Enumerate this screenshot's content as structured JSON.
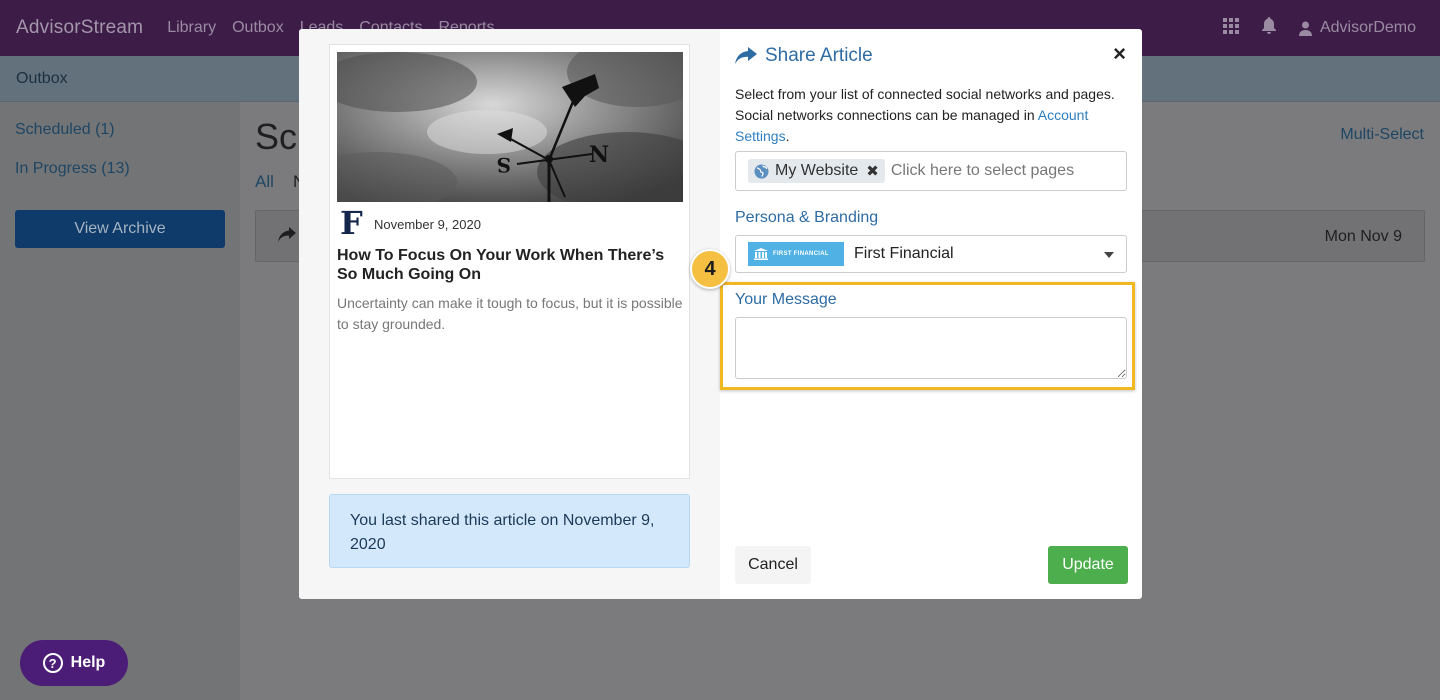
{
  "app": {
    "brand": "AdvisorStream",
    "nav": [
      "Library",
      "Outbox",
      "Leads",
      "Contacts",
      "Reports"
    ],
    "user": "AdvisorDemo",
    "icons": [
      "grid-icon",
      "bell-icon",
      "user-icon"
    ]
  },
  "subheader": {
    "title": "Outbox"
  },
  "sidebar": {
    "items": [
      {
        "label": "Scheduled (1)"
      },
      {
        "label": "In Progress (13)"
      }
    ],
    "archive_button": "View Archive"
  },
  "main": {
    "title": "Sch",
    "filter_all": "All",
    "filter_next": "N",
    "multi_select": "Multi-Select",
    "row_date": "Mon Nov 9"
  },
  "help": {
    "label": "Help"
  },
  "modal": {
    "article": {
      "publisher_logo": "F",
      "date": "November 9, 2020",
      "title": "How To Focus On Your Work When There’s So Much Going On",
      "description": "Uncertainty can make it tough to focus, but it is possible to stay grounded."
    },
    "shared_note": "You last shared this article on November 9, 2020",
    "share": {
      "title": "Share Article",
      "description_before": "Select from your list of connected social networks and pages. Social networks connections can be managed in ",
      "description_link": "Account Settings",
      "description_after": ".",
      "selected_tag": "My Website",
      "placeholder": "Click here to select pages",
      "persona_label": "Persona & Branding",
      "persona_logo_text": "FIRST FINANCIAL",
      "persona_value": "First Financial",
      "message_label": "Your Message",
      "message_value": "",
      "step_number": "4",
      "cancel": "Cancel",
      "update": "Update"
    }
  },
  "colors": {
    "nav_bg": "#3d1d47",
    "link": "#2e6ca4",
    "highlight": "#f1b821",
    "update_btn": "#4cae4c",
    "note_bg": "#d3e8fb"
  }
}
